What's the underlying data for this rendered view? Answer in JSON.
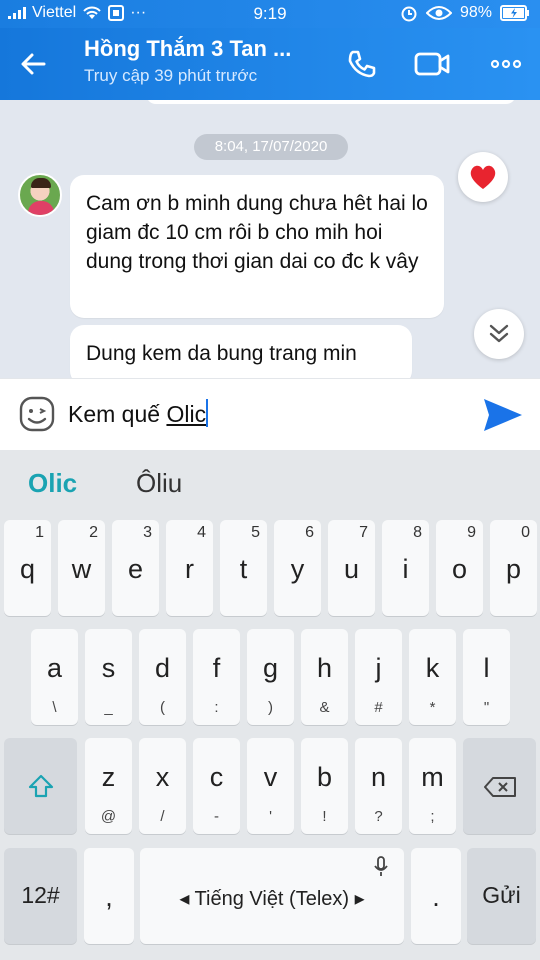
{
  "status_bar": {
    "carrier": "Viettel",
    "time": "9:19",
    "battery": "98%",
    "dots": "···"
  },
  "header": {
    "title": "Hồng Thắm 3 Tan ...",
    "subtitle": "Truy cập 39 phút trước"
  },
  "chat": {
    "date_separator": "8:04, 17/07/2020",
    "messages": [
      {
        "text": "Cam ơn b minh dung chưa hêt hai lo giam đc 10 cm rôi b cho mih hoi dung trong thơi gian dai co đc k vây"
      },
      {
        "text": "Dung kem da bung trang min"
      }
    ],
    "reaction": "heart-icon"
  },
  "composer": {
    "text_before": "Kem quế ",
    "text_composing": "Olic"
  },
  "keyboard": {
    "suggestions": [
      "Olic",
      "Ôliu"
    ],
    "row1": [
      {
        "k": "q",
        "h": "1"
      },
      {
        "k": "w",
        "h": "2"
      },
      {
        "k": "e",
        "h": "3"
      },
      {
        "k": "r",
        "h": "4"
      },
      {
        "k": "t",
        "h": "5"
      },
      {
        "k": "y",
        "h": "6"
      },
      {
        "k": "u",
        "h": "7"
      },
      {
        "k": "i",
        "h": "8"
      },
      {
        "k": "o",
        "h": "9"
      },
      {
        "k": "p",
        "h": "0"
      }
    ],
    "row2": [
      {
        "k": "a",
        "h": "\\"
      },
      {
        "k": "s",
        "h": "_"
      },
      {
        "k": "d",
        "h": "("
      },
      {
        "k": "f",
        "h": ":"
      },
      {
        "k": "g",
        "h": ")"
      },
      {
        "k": "h",
        "h": "&"
      },
      {
        "k": "j",
        "h": "#"
      },
      {
        "k": "k",
        "h": "*"
      },
      {
        "k": "l",
        "h": "\""
      }
    ],
    "row3": [
      {
        "k": "z",
        "h": "@"
      },
      {
        "k": "x",
        "h": "/"
      },
      {
        "k": "c",
        "h": "-"
      },
      {
        "k": "v",
        "h": "'"
      },
      {
        "k": "b",
        "h": "!"
      },
      {
        "k": "n",
        "h": "?"
      },
      {
        "k": "m",
        "h": ";"
      }
    ],
    "numbers_label": "12#",
    "comma": ",",
    "space_label": "Tiếng Việt (Telex)",
    "period": ".",
    "send_label": "Gửi"
  },
  "colors": {
    "header": "#1a7de0",
    "suggestion_active": "#1aa3b2",
    "send": "#1a73e8"
  }
}
